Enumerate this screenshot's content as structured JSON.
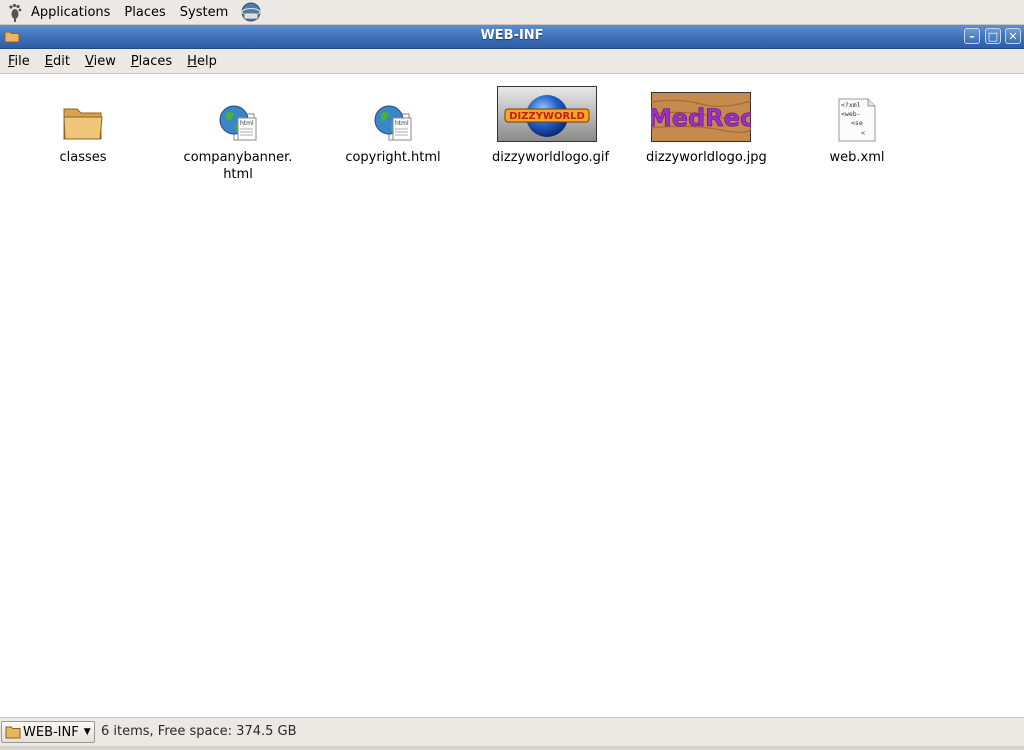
{
  "panel": {
    "menus": [
      "Applications",
      "Places",
      "System"
    ]
  },
  "window": {
    "title": "WEB-INF",
    "buttons": {
      "minimize": "–",
      "maximize": "□",
      "close": "✕"
    }
  },
  "menubar": {
    "items": [
      {
        "label": "File",
        "mnemonic": "F",
        "rest": "ile"
      },
      {
        "label": "Edit",
        "mnemonic": "E",
        "rest": "dit"
      },
      {
        "label": "View",
        "mnemonic": "V",
        "rest": "iew"
      },
      {
        "label": "Places",
        "mnemonic": "P",
        "rest": "laces"
      },
      {
        "label": "Help",
        "mnemonic": "H",
        "rest": "elp"
      }
    ]
  },
  "files": [
    {
      "name": "classes",
      "icon": "folder-icon"
    },
    {
      "name": "companybanner.\nhtml",
      "icon": "html-file-icon"
    },
    {
      "name": "copyright.html",
      "icon": "html-file-icon"
    },
    {
      "name": "dizzyworldlogo.gif",
      "icon": "image-thumbnail",
      "thumb_text": "DIZZYWORLD"
    },
    {
      "name": "dizzyworldlogo.jpg",
      "icon": "image-thumbnail",
      "thumb_text": "MedRec"
    },
    {
      "name": "web.xml",
      "icon": "text-file-icon",
      "preview_lines": [
        "<?xml",
        "<web-",
        "<se",
        "<"
      ]
    }
  ],
  "statusbar": {
    "location": "WEB-INF",
    "info": "6 items, Free space: 374.5 GB"
  },
  "colors": {
    "titlebar": "#3b6fb8",
    "panel": "#ece9e4",
    "folder": "#e8b660"
  }
}
